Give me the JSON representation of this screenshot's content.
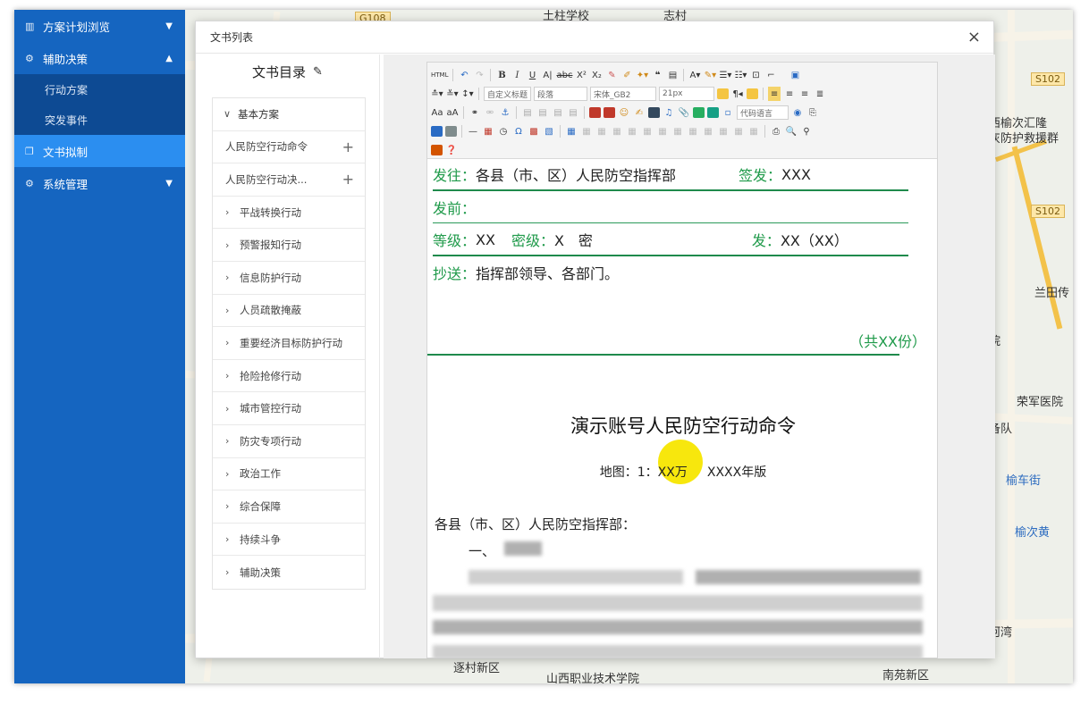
{
  "sidebar": {
    "items": [
      {
        "label": "方案计划浏览",
        "icon": "chart-icon",
        "caret": "▼"
      },
      {
        "label": "辅助决策",
        "icon": "gear-icon",
        "caret": "▲"
      },
      {
        "label": "行动方案"
      },
      {
        "label": "突发事件"
      },
      {
        "label": "文书拟制",
        "icon": "document-icon"
      },
      {
        "label": "系统管理",
        "icon": "settings-icon",
        "caret": "▼"
      }
    ]
  },
  "map": {
    "labels": [
      "土柱学校",
      "志村",
      "G108",
      "S102",
      "西榆次汇隆",
      "灰防护救援群",
      "S102",
      "兰田传",
      "院",
      "荣军医院",
      "备队",
      "榆车街",
      "榆次黄",
      "河湾",
      "南苑新区",
      "山西职业技术学院",
      "逐村新区"
    ]
  },
  "modal": {
    "title": "文书列表",
    "close": "×"
  },
  "catalog": {
    "title": "文书目录",
    "edit_icon": "✎",
    "header": "基本方案",
    "items": [
      {
        "label": "人民防空行动命令",
        "plus": "+"
      },
      {
        "label": "人民防空行动决...",
        "plus": "+"
      },
      {
        "label": "平战转换行动"
      },
      {
        "label": "预警报知行动"
      },
      {
        "label": "信息防护行动"
      },
      {
        "label": "人员疏散掩蔽"
      },
      {
        "label": "重要经济目标防护行动"
      },
      {
        "label": "抢险抢修行动"
      },
      {
        "label": "城市管控行动"
      },
      {
        "label": "防灾专项行动"
      },
      {
        "label": "政治工作"
      },
      {
        "label": "综合保障"
      },
      {
        "label": "持续斗争"
      },
      {
        "label": "辅助决策"
      }
    ]
  },
  "toolbar": {
    "html": "HTML",
    "heading_select": "自定义标题",
    "para_select": "段落",
    "font_select": "宋体_GB2",
    "size_select": "21px",
    "lang_select": "代码语言"
  },
  "document": {
    "send_label": "发往：",
    "send_value": "各县（市、区）人民防空指挥部",
    "sign_label": "签发：",
    "sign_value": "XXX",
    "before_label": "发前：",
    "level_label": "等级：",
    "level_value": "XX",
    "secret_label": "密级：",
    "secret_value": "X　密",
    "issue_label": "发：",
    "issue_value": "XX（XX）",
    "cc_label": "抄送：",
    "cc_value": "指挥部领导、各部门。",
    "copies": "（共XX份）",
    "title": "演示账号人民防空行动命令",
    "map_label": "地图：",
    "map_scale": "1：XX万",
    "map_edition": "XXXX年版",
    "addressee": "各县（市、区）人民防空指挥部：",
    "section_one": "一、"
  }
}
